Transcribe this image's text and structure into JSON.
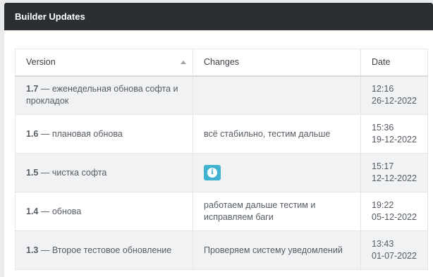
{
  "panel": {
    "title": "Builder Updates"
  },
  "table": {
    "headers": {
      "version": "Version",
      "changes": "Changes",
      "date": "Date"
    },
    "rows": [
      {
        "version": "1.7",
        "title": " — еженедельная обнова софта и прокладок",
        "changes": "",
        "time": "12:16",
        "date": "26-12-2022"
      },
      {
        "version": "1.6",
        "title": " — плановая обнова",
        "changes": "всё стабильно, тестим дальше",
        "time": "15:36",
        "date": "19-12-2022"
      },
      {
        "version": "1.5",
        "title": " — чистка софта",
        "changes": "",
        "time": "15:17",
        "date": "12-12-2022"
      },
      {
        "version": "1.4",
        "title": " — обнова",
        "changes": "работаем дальше тестим и исправляем баги",
        "time": "19:22",
        "date": "05-12-2022"
      },
      {
        "version": "1.3",
        "title": " — Второе тестовое обновление",
        "changes": "Проверяем систему уведомлений",
        "time": "13:43",
        "date": "01-07-2022"
      }
    ]
  },
  "icons": {
    "info": "info-icon",
    "sort": "sort-asc-icon"
  },
  "colors": {
    "header_bg": "#2b2e33",
    "info_button": "#3fb2d0",
    "odd_row": "#f1f2f4"
  }
}
